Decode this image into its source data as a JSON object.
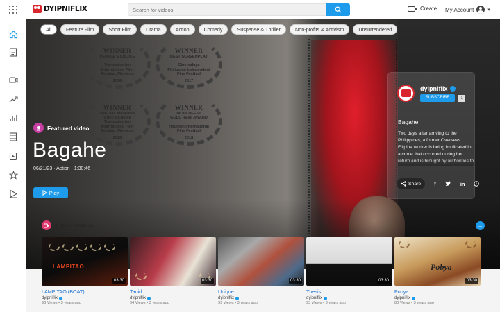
{
  "header": {
    "logo_text": "DYIPNIFLIX",
    "search_placeholder": "Search for videos",
    "create_label": "Create",
    "account_label": "My Account"
  },
  "sidebar": {
    "items": [
      {
        "icon": "home-icon"
      },
      {
        "icon": "document-icon"
      },
      {
        "icon": "video-icon"
      },
      {
        "icon": "trending-icon"
      },
      {
        "icon": "chart-icon"
      },
      {
        "icon": "film-icon"
      },
      {
        "icon": "add-video-icon"
      },
      {
        "icon": "star-icon"
      },
      {
        "icon": "playlist-icon"
      }
    ]
  },
  "categories": [
    "All",
    "Feature Film",
    "Short Film",
    "Drama",
    "Action",
    "Comedy",
    "Suspense & Thriller",
    "Non-profits & Activism",
    "Unsurrendered"
  ],
  "hero": {
    "featured_label": "Featured video",
    "title": "Bagahe",
    "meta": "06/21/23  ·  Action  ·  1:30:46",
    "play_label": "Play",
    "awards": [
      {
        "win": "WINNER",
        "sub": "PEOPLE'S CHOICE\n\nTranssaharien\nInternational Film\nFestival, Morocco",
        "year": "2018"
      },
      {
        "win": "WINNER",
        "sub": "BEST SCREENPLAY\n\nCinemalaya\nPhilippine Independent\nFilm Festival",
        "year": "2017"
      },
      {
        "win": "WINNER",
        "sub": "SPECIAL MENTION\nCritic's Choice\nTranssaharien\nInternational Film\nFestival, Morocco",
        "year": "2018"
      },
      {
        "win": "WINNER",
        "sub": "WORLDFEST\nGOLD REMI AWARD\n\nHouston International\nFilm Festival",
        "year": "2018"
      }
    ]
  },
  "channel_card": {
    "name": "dyipniflix",
    "subscribe_label": "SUBSCRIBE",
    "subscriber_count": "1",
    "video_title": "Bagahe",
    "description": "Two days after arriving to the Philippines, a former Overseas Filipina worker is being implicated in a crime that occurred during her return and is brought by authorities to the country's capital to prove her innocence.",
    "share_label": "Share"
  },
  "latest": {
    "heading": "Latest videos",
    "videos": [
      {
        "title": "LAMPITAO (BOAT)",
        "channel": "dyipniflix",
        "meta": "98 Views • 3 years ago",
        "duration": "03:30",
        "thumb_text": "LAMPITAO"
      },
      {
        "title": "Taoid",
        "channel": "dyipniflix",
        "meta": "94 Views • 3 years ago",
        "duration": "03:30",
        "thumb_text": ""
      },
      {
        "title": "Unique",
        "channel": "dyipniflix",
        "meta": "99 Views • 3 years ago",
        "duration": "03:30",
        "thumb_text": ""
      },
      {
        "title": "Thesis",
        "channel": "dyipniflix",
        "meta": "93 Views • 3 years ago",
        "duration": "03:30",
        "thumb_text": ""
      },
      {
        "title": "Pobya",
        "channel": "dyipniflix",
        "meta": "80 Views • 3 years ago",
        "duration": "03:30",
        "thumb_text": "Pobya"
      }
    ]
  },
  "colors": {
    "accent": "#1e9bea",
    "brand_red": "#d9262e",
    "featured_badge": "#c83fa3",
    "latest_badge": "#e03a6f"
  }
}
